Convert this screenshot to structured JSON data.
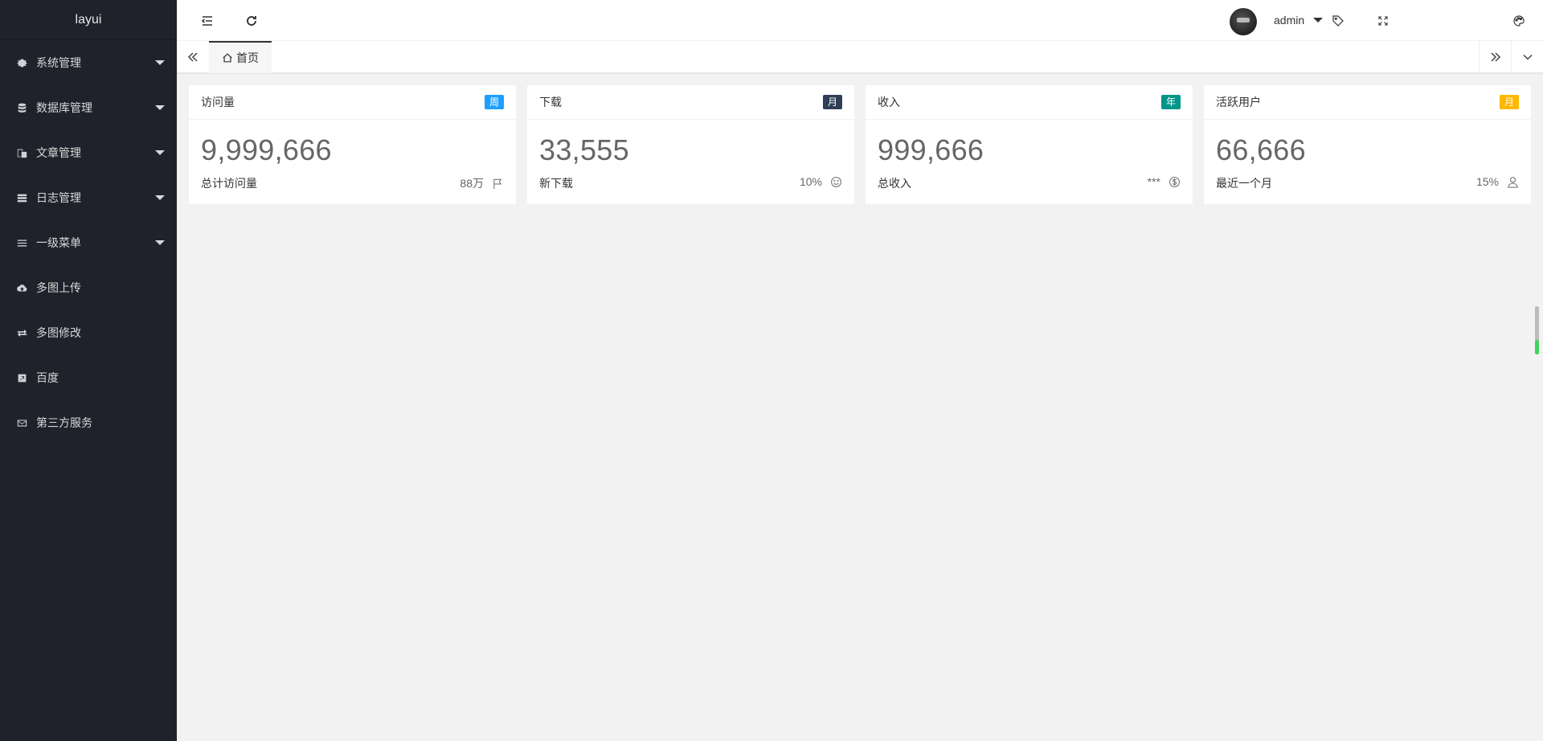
{
  "logo": "layui",
  "sidebar": {
    "items": [
      {
        "label": "系统管理",
        "icon": "gear-icon",
        "has_submenu": true
      },
      {
        "label": "数据库管理",
        "icon": "database-icon",
        "has_submenu": true
      },
      {
        "label": "文章管理",
        "icon": "documents-icon",
        "has_submenu": true
      },
      {
        "label": "日志管理",
        "icon": "server-list-icon",
        "has_submenu": true
      },
      {
        "label": "一级菜单",
        "icon": "bars-icon",
        "has_submenu": true
      },
      {
        "label": "多图上传",
        "icon": "cloud-upload-icon",
        "has_submenu": false
      },
      {
        "label": "多图修改",
        "icon": "exchange-icon",
        "has_submenu": false
      },
      {
        "label": "百度",
        "icon": "external-link-icon",
        "has_submenu": false
      },
      {
        "label": "第三方服务",
        "icon": "envelope-icon",
        "has_submenu": false
      }
    ]
  },
  "header": {
    "user_name": "admin",
    "icons": [
      "menu-fold-icon",
      "refresh-icon",
      "tag-icon",
      "fullscreen-icon",
      "avatar",
      "theme-palette-icon"
    ]
  },
  "tabs": {
    "home_label": "首页",
    "icons": [
      "prev-tabs-icon",
      "home-icon",
      "next-tabs-icon",
      "tabs-dropdown-icon"
    ]
  },
  "cards": [
    {
      "title": "访问量",
      "badge": "周",
      "badge_color": "#1e9fff",
      "value": "9,999,666",
      "foot_label": "总计访问量",
      "foot_value": "88万",
      "foot_icon": "flag-icon"
    },
    {
      "title": "下载",
      "badge": "月",
      "badge_color": "#2f4056",
      "value": "33,555",
      "foot_label": "新下载",
      "foot_value": "10%",
      "foot_icon": "smile-icon"
    },
    {
      "title": "收入",
      "badge": "年",
      "badge_color": "#009688",
      "value": "999,666",
      "foot_label": "总收入",
      "foot_value": "***",
      "foot_icon": "dollar-icon"
    },
    {
      "title": "活跃用户",
      "badge": "月",
      "badge_color": "#ffb800",
      "value": "66,666",
      "foot_label": "最近一个月",
      "foot_value": "15%",
      "foot_icon": "user-icon"
    }
  ],
  "colors": {
    "sidebar_bg": "#1f222a",
    "body_bg": "#f2f2f2",
    "card_bg": "#ffffff"
  }
}
